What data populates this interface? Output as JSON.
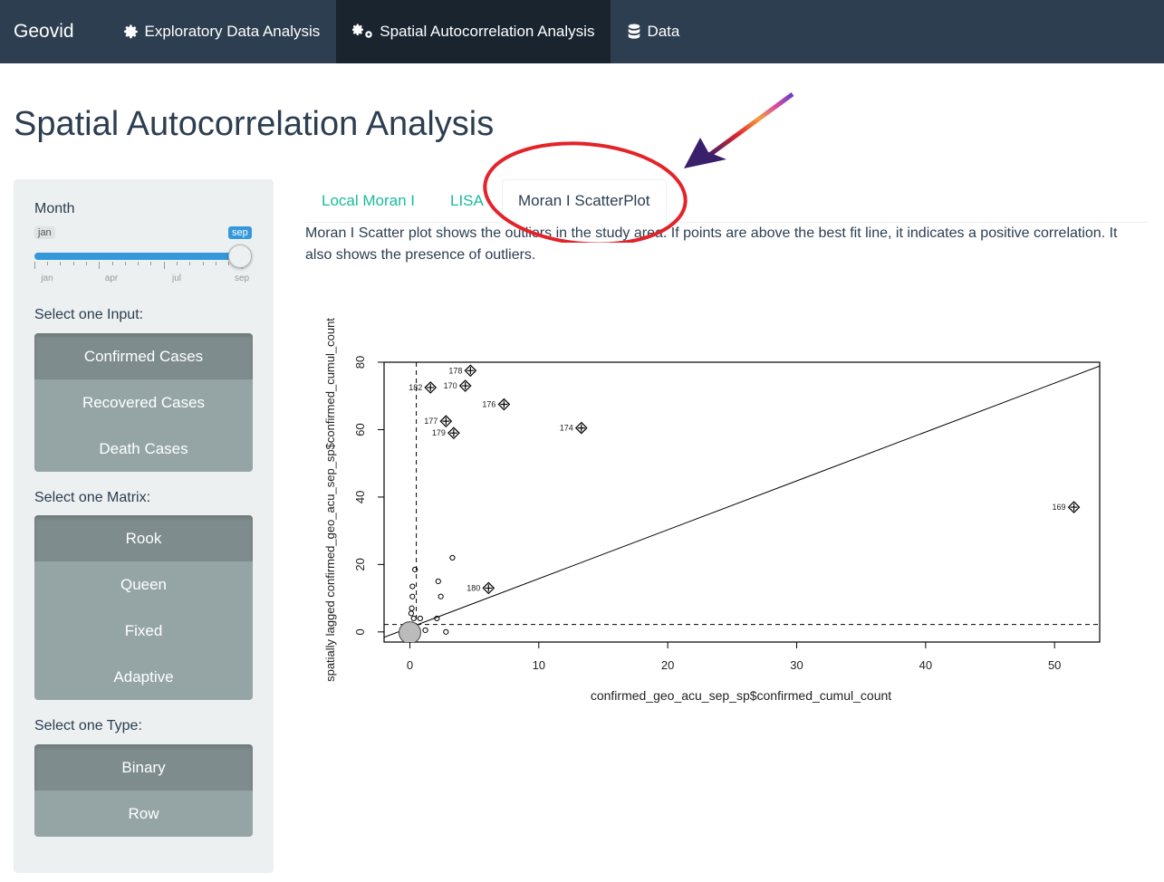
{
  "navbar": {
    "brand": "Geovid",
    "items": [
      {
        "label": "Exploratory Data Analysis",
        "icon": "gear-icon",
        "active": false
      },
      {
        "label": "Spatial Autocorrelation Analysis",
        "icon": "gears-icon",
        "active": true
      },
      {
        "label": "Data",
        "icon": "database-icon",
        "active": false
      }
    ]
  },
  "page_title": "Spatial Autocorrelation Analysis",
  "sidebar": {
    "month_label": "Month",
    "slider": {
      "min_label": "jan",
      "max_label": "sep",
      "ticks": [
        "jan",
        "apr",
        "jul",
        "sep"
      ],
      "value": "sep"
    },
    "input_label": "Select one Input:",
    "inputs": [
      {
        "label": "Confirmed Cases",
        "active": true
      },
      {
        "label": "Recovered Cases",
        "active": false
      },
      {
        "label": "Death Cases",
        "active": false
      }
    ],
    "matrix_label": "Select one Matrix:",
    "matrices": [
      {
        "label": "Rook",
        "active": true
      },
      {
        "label": "Queen",
        "active": false
      },
      {
        "label": "Fixed",
        "active": false
      },
      {
        "label": "Adaptive",
        "active": false
      }
    ],
    "type_label": "Select one Type:",
    "types": [
      {
        "label": "Binary",
        "active": true
      },
      {
        "label": "Row",
        "active": false
      }
    ]
  },
  "tabs": [
    {
      "label": "Local Moran I",
      "active": false
    },
    {
      "label": "LISA",
      "active": false
    },
    {
      "label": "Moran I ScatterPlot",
      "active": true
    }
  ],
  "description": "Moran I Scatter plot shows the outliers in the study area. If points are above the best fit line, it indicates a positive correlation. It also shows the presence of outliers.",
  "chart_data": {
    "type": "scatter",
    "xlabel": "confirmed_geo_acu_sep_sp$confirmed_cumul_count",
    "ylabel": "spatially lagged confirmed_geo_acu_sep_sp$confirmed_cumul_count",
    "xlim": [
      -2,
      53.5
    ],
    "ylim": [
      -3,
      80
    ],
    "xticks": [
      0,
      10,
      20,
      30,
      40,
      50
    ],
    "yticks": [
      0,
      20,
      40,
      60,
      80
    ],
    "mean_x": 0.5,
    "mean_y": 2.2,
    "fit_line": {
      "intercept": 1.3,
      "slope": 1.45
    },
    "influential_points": [
      {
        "label": "178",
        "x": 4.7,
        "y": 77.5
      },
      {
        "label": "182",
        "x": 1.6,
        "y": 72.5
      },
      {
        "label": "170",
        "x": 4.3,
        "y": 73
      },
      {
        "label": "176",
        "x": 7.3,
        "y": 67.5
      },
      {
        "label": "177",
        "x": 2.8,
        "y": 62.5
      },
      {
        "label": "179",
        "x": 3.4,
        "y": 59
      },
      {
        "label": "174",
        "x": 13.3,
        "y": 60.5
      },
      {
        "label": "169",
        "x": 51.5,
        "y": 37
      },
      {
        "label": "180",
        "x": 6.1,
        "y": 13
      }
    ],
    "points": [
      {
        "x": 0.4,
        "y": 18.5
      },
      {
        "x": 0.2,
        "y": 13.5
      },
      {
        "x": 0.2,
        "y": 10.5
      },
      {
        "x": 0.15,
        "y": 7
      },
      {
        "x": 0.1,
        "y": 5.5
      },
      {
        "x": 0.3,
        "y": 4
      },
      {
        "x": 0.8,
        "y": 4
      },
      {
        "x": 1.2,
        "y": 0.5
      },
      {
        "x": 2.2,
        "y": 15
      },
      {
        "x": 2.4,
        "y": 10.5
      },
      {
        "x": 3.3,
        "y": 22
      },
      {
        "x": 2.1,
        "y": 4
      },
      {
        "x": 2.8,
        "y": 0
      },
      {
        "x": 0.05,
        "y": 0
      },
      {
        "x": 0,
        "y": 0
      }
    ]
  },
  "colors": {
    "navbar": "#2c3e50",
    "navbar_active": "#1a242f",
    "tab_link": "#18bc9c",
    "button": "#95a5a6",
    "button_active": "#7f8c8d",
    "slider": "#3498db",
    "annotation": "#e3232a"
  }
}
